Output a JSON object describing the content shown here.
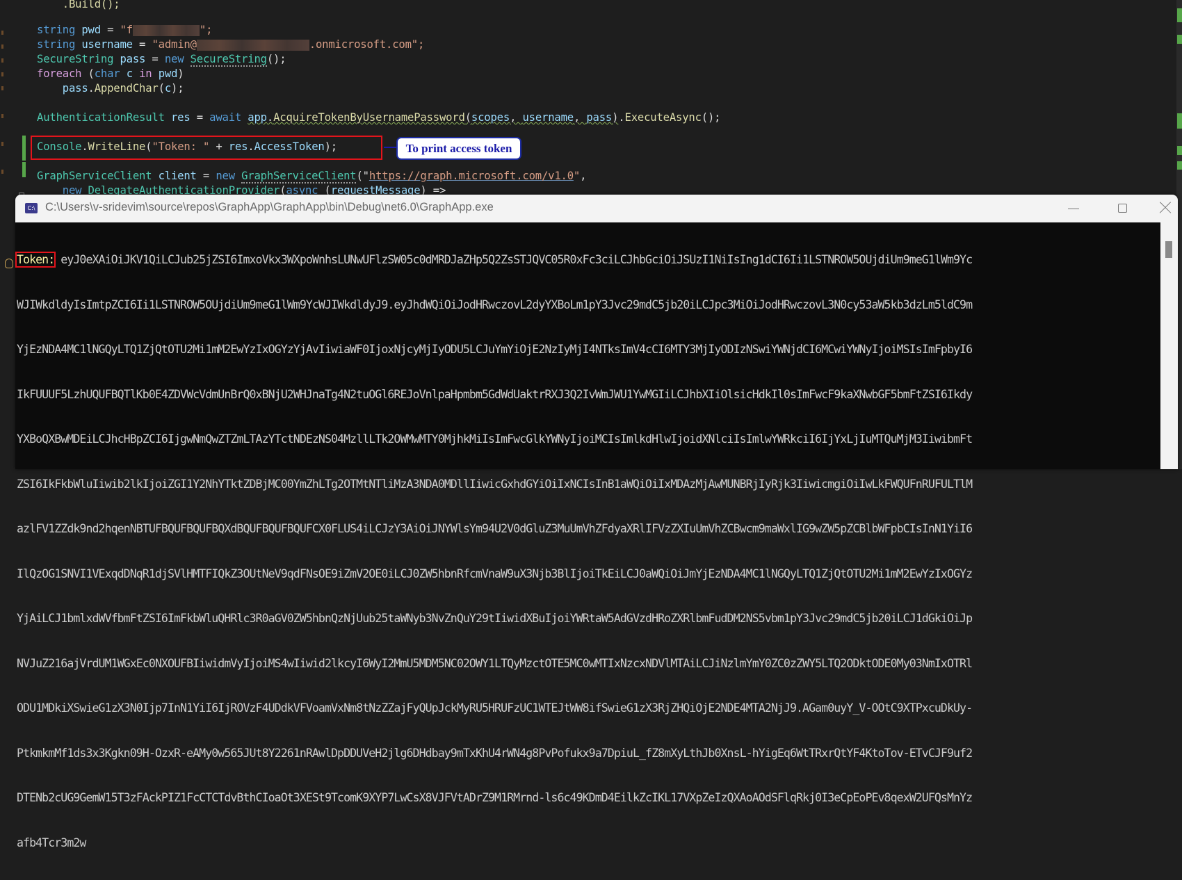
{
  "editor": {
    "lines": {
      "build": ".Build();",
      "pwd_kw": "string",
      "pwd_var": "pwd",
      "pwd_prefix": "\"f",
      "pwd_suffix": "\";",
      "user_kw": "string",
      "user_var": "username",
      "user_prefix": "\"admin@",
      "user_suffix": ".onmicrosoft.com\";",
      "secure_type": "SecureString",
      "secure_var": "pass",
      "secure_new": "new",
      "secure_ctor": "SecureString",
      "secure_end": "();",
      "foreach_kw": "foreach",
      "foreach_char": "char",
      "foreach_c": "c",
      "foreach_in": "in",
      "foreach_pwd": "pwd",
      "append_obj": "pass",
      "append_fn": "AppendChar",
      "append_arg": "c",
      "auth_type": "AuthenticationResult",
      "auth_var": "res",
      "auth_await": "await",
      "auth_app": "app",
      "auth_fn": "AcquireTokenByUsernamePassword",
      "auth_arg1": "scopes",
      "auth_arg2": "username",
      "auth_arg3": "pass",
      "auth_exec": "ExecuteAsync",
      "console_type": "Console",
      "console_fn": "WriteLine",
      "console_str": "\"Token: \"",
      "console_obj": "res",
      "console_prop": "AccessToken",
      "graph_type": "GraphServiceClient",
      "graph_var": "client",
      "graph_new": "new",
      "graph_ctor": "GraphServiceClient",
      "graph_url": "https://graph.microsoft.com/v1.0",
      "delegate_new": "new",
      "delegate_type": "DelegateAuthenticationProvider",
      "delegate_async": "async",
      "delegate_param": "requestMessage",
      "delegate_arrow": "=>"
    },
    "annotation": "To print access token",
    "colors": {
      "highlight_box": "#e3141b",
      "callout_text": "#1a1aa8",
      "change_bar": "#57a64a"
    }
  },
  "console": {
    "title": "C:\\Users\\v-sridevim\\source\\repos\\GraphApp\\GraphApp\\bin\\Debug\\net6.0\\GraphApp.exe",
    "app_icon": "C:\\",
    "token_label": "Token:",
    "token_lines": [
      " eyJ0eXAiOiJKV1QiLCJub25jZSI6ImxoVkx3WXpoWnhsLUNwUFlzSW05c0dMRDJaZHp5Q2ZsSTJQVC05R0xFc3ciLCJhbGciOiJSUzI1NiIsIng1dCI6Ii1LSTNROW5OUjdiUm9meG1lWm9Yc",
      "WJIWkdldyIsImtpZCI6Ii1LSTNROW5OUjdiUm9meG1lWm9YcWJIWkdldyJ9.eyJhdWQiOiJodHRwczovL2dyYXBoLm1pY3Jvc29mdC5jb20iLCJpc3MiOiJodHRwczovL3N0cy53aW5kb3dzLm5ldC9m",
      "YjEzNDA4MC1lNGQyLTQ1ZjQtOTU2Mi1mM2EwYzIxOGYzYjAvIiwiaWF0IjoxNjcyMjIyODU5LCJuYmYiOjE2NzIyMjI4NTksImV4cCI6MTY3MjIyODIzNSwiYWNjdCI6MCwiYWNyIjoiMSIsImFpbyI6",
      "IkFUUUF5LzhUQUFBQTlKb0E4ZDVWcVdmUnBrQ0xBNjU2WHJnaTg4N2tuOGl6REJoVnlpaHpmbm5GdWdUaktrRXJ3Q2IvWmJWU1YwMGIiLCJhbXIiOlsicHdkIl0sImFwcF9kaXNwbGF5bmFtZSI6Ikdy",
      "YXBoQXBwMDEiLCJhcHBpZCI6IjgwNmQwZTZmLTAzYTctNDEzNS04MzllLTk2OWMwMTY0MjhkMiIsImFwcGlkYWNyIjoiMCIsImlkdHlwIjoidXNlciIsImlwYWRkciI6IjYxLjIuMTQuMjM3IiwibmFt",
      "ZSI6IkFkbWluIiwib2lkIjoiZGI1Y2NhYTktZDBjMC00YmZhLTg2OTMtNTliMzA3NDA0MDllIiwicGxhdGYiOiIxNCIsInB1aWQiOiIxMDAzMjAwMUNBRjIyRjk3IiwicmgiOiIwLkFWQUFnRUFULTlM",
      "azlFV1ZZdk9nd2hqenNBTUFBQUFBQUFBQXdBQUFBQUFBQUFCX0FLUS4iLCJzY3AiOiJNYWlsYm94U2V0dGluZ3MuUmVhZFdyaXRlIFVzZXIuUmVhZCBwcm9maWxlIG9wZW5pZCBlbWFpbCIsInN1YiI6",
      "IlQzOG1SNVI1VExqdDNqR1djSVlHMTFIQkZ3OUtNeV9qdFNsOE9iZmV2OE0iLCJ0ZW5hbnRfcmVnaW9uX3Njb3BlIjoiTkEiLCJ0aWQiOiJmYjEzNDA4MC1lNGQyLTQ1ZjQtOTU2Mi1mM2EwYzIxOGYz",
      "YjAiLCJ1bmlxdWVfbmFtZSI6ImFkbWluQHRlc3R0aGV0ZW5hbnQzNjUub25taWNyb3NvZnQuY29tIiwidXBuIjoiYWRtaW5AdGVzdHRoZXRlbmFudDM2NS5vbm1pY3Jvc29mdC5jb20iLCJ1dGkiOiJp",
      "NVJuZ216ajVrdUM1WGxEc0NXOUFBIiwidmVyIjoiMS4wIiwid2lkcyI6WyI2MmU5MDM5NC02OWY1LTQyMzctOTE5MC0wMTIxNzcxNDVlMTAiLCJiNzlmYmY0ZC0zZWY5LTQ2ODktODE0My03NmIxOTRl",
      "ODU1MDkiXSwieG1zX3N0Ijp7InN1YiI6IjROVzF4UDdkVFVoamVxNm8tNzZZajFyQUpJckMyRU5HRUFzUC1WTEJtWW8ifSwieG1zX3RjZHQiOjE2NDE4MTA2NjJ9.AGam0uyY_V-OOtC9XTPxcuDkUy-",
      "PtkmkmMf1ds3x3Kgkn09H-OzxR-eAMy0w565JUt8Y2261nRAwlDpDDUVeH2jlg6DHdbay9mTxKhU4rWN4g8PvPofukx9a7DpiuL_fZ8mXyLthJb0XnsL-hYigEq6WtTRxrQtYF4KtoTov-ETvCJF9uf2",
      "DTENb2cUG9GemW15T3zFAckPIZ1FcCTCTdvBthCIoaOt3XESt9TcomK9XYP7LwCsX8VJFVtADrZ9M1RMrnd-ls6c49KDmD4EilkZcIKL17VXpZeIzQXAoAOdSFlqRkj0I3eCpEoPEv8qexW2UFQsMnYz",
      "afb4Tcr3m2w"
    ],
    "window_buttons": {
      "minimize": "minimize-icon",
      "maximize": "maximize-icon",
      "close": "close-icon"
    }
  }
}
